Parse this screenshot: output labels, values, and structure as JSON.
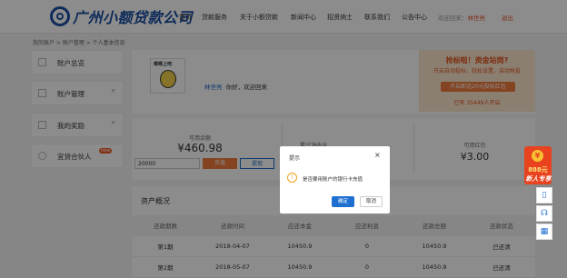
{
  "header": {
    "logo_text": "广州小额贷款公司",
    "nav": [
      "首页",
      "贷款服务",
      "关于小额贷款",
      "新闻中心",
      "招贤纳士",
      "联系我们",
      "公告中心"
    ],
    "welcome_prefix": "欢迎回来：",
    "username": "林世亮",
    "logout": "退出"
  },
  "breadcrumb": "我的账户 > 账户管理 > 个人基本信息",
  "sidebar": {
    "items": [
      {
        "label": "账户总览",
        "icon": "monitor-icon"
      },
      {
        "label": "账户管理",
        "icon": "chart-icon"
      },
      {
        "label": "我的奖励",
        "icon": "gift-icon"
      },
      {
        "label": "宜贷合伙人",
        "icon": "partner-icon",
        "badge": "new"
      }
    ]
  },
  "profile": {
    "avatar_caption": "嗯嗯上吧",
    "username": "林世亮",
    "greeting": "你好，欢迎回来"
  },
  "promo": {
    "title": "抢标啦！资金站岗?",
    "subtitle": "开启自动投标，轻松设置，自动抢投",
    "button": "开启即送20元投标红包",
    "count": "已有 35449人开启"
  },
  "stats": {
    "available_label": "可用余额",
    "available_value": "¥460.98",
    "amount_input": "20000",
    "recharge": "充值",
    "withdraw": "提现",
    "income_label": "累计净收益",
    "redpacket_label": "可用红包",
    "redpacket_value": "¥3.00"
  },
  "asset": {
    "title": "资产概况",
    "columns": [
      "还款期数",
      "还款时间",
      "应还本金",
      "应还利息",
      "还款总额",
      "还款状态"
    ],
    "rows": [
      [
        "第1期",
        "2018-04-07",
        "10450.9",
        "0",
        "10450.9",
        "已还清"
      ],
      [
        "第2期",
        "2018-05-07",
        "10450.9",
        "0",
        "10450.9",
        "已还清"
      ]
    ]
  },
  "dialog": {
    "title": "提示",
    "close": "×",
    "message": "是否要用账户的银行卡充值",
    "ok": "确定",
    "cancel": "取消"
  },
  "float": {
    "coin": "¥",
    "amount": "888元",
    "label": "新人专享"
  }
}
